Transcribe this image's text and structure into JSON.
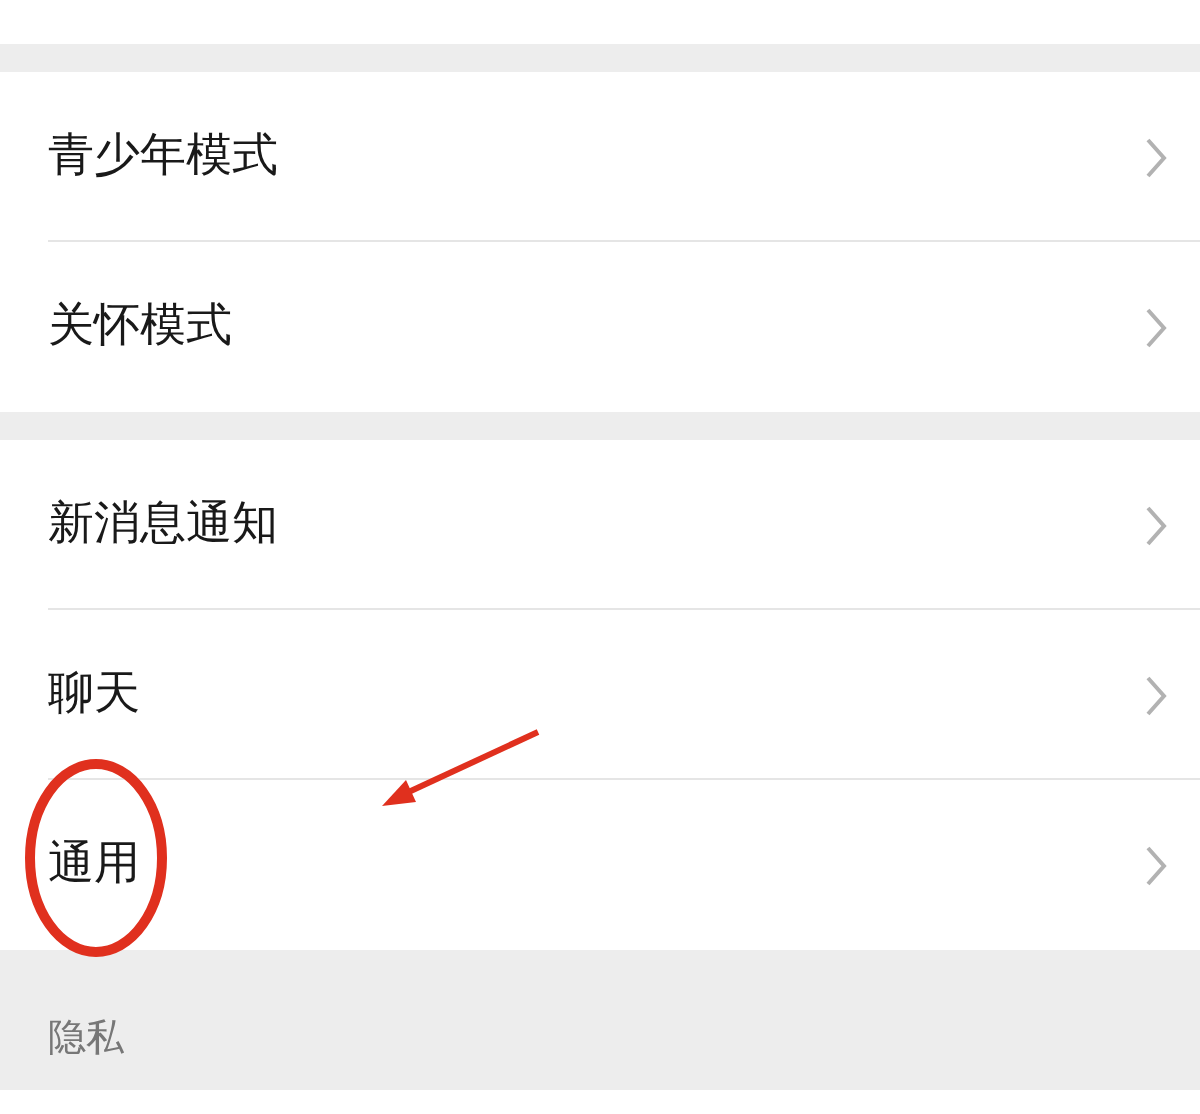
{
  "groups": [
    {
      "items": [
        {
          "label": "青少年模式"
        },
        {
          "label": "关怀模式"
        }
      ]
    },
    {
      "items": [
        {
          "label": "新消息通知"
        },
        {
          "label": "聊天"
        },
        {
          "label": "通用"
        }
      ]
    }
  ],
  "section_header": "隐私"
}
